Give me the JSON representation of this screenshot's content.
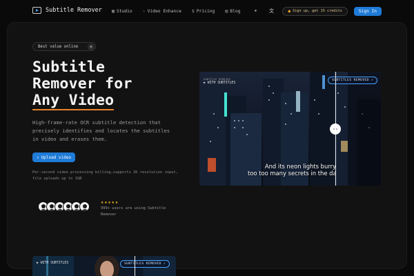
{
  "nav": {
    "logo_text": "Subtitle Remover",
    "links": [
      {
        "icon": "studio-icon",
        "label": "Studio"
      },
      {
        "icon": "video-enhance-icon",
        "label": "Video Enhance"
      },
      {
        "icon": "dollar-icon",
        "label": "Pricing"
      },
      {
        "icon": "blog-icon",
        "label": "Blog"
      }
    ],
    "theme_icon": "sun-icon",
    "language_icon": "translate-icon",
    "credit_pill": "Sign up, get 15 credits",
    "signin_label": "Sign In"
  },
  "hero": {
    "badge": "Best value online",
    "title_line1": "Subtitle",
    "title_line2": "Remover for",
    "title_accent": "Any Video",
    "description": "High-frame-rate OCR subtitle detection that precisely identifies and locates the subtitles in video and erases them.",
    "upload_label": "Upload video",
    "note": "Per-second video processing billing,supports 2K resolution input, file uploads up to 1GB"
  },
  "social": {
    "stars": "★★★★★",
    "rating": 5,
    "users_text": "999+ users are using Subtitle Remover"
  },
  "compare": {
    "left_tag_small": "SUBTITLE REMOVER",
    "left_tag": "WITH SUBTITLES",
    "right_tag": "SUBTITLES REMOVED",
    "caption_line1": "And its neon lights burry",
    "caption_line2": "too too many secrets in the dark.",
    "handle_glyph": "‹›"
  },
  "compare2": {
    "left_tag": "WITH SUBTITLES",
    "right_tag": "SUBTITLES REMOVED"
  },
  "colors": {
    "accent_blue": "#1f7bd8",
    "accent_orange": "#e6832a",
    "star": "#f5b623",
    "background": "#0a0a0a",
    "panel": "#121212"
  }
}
